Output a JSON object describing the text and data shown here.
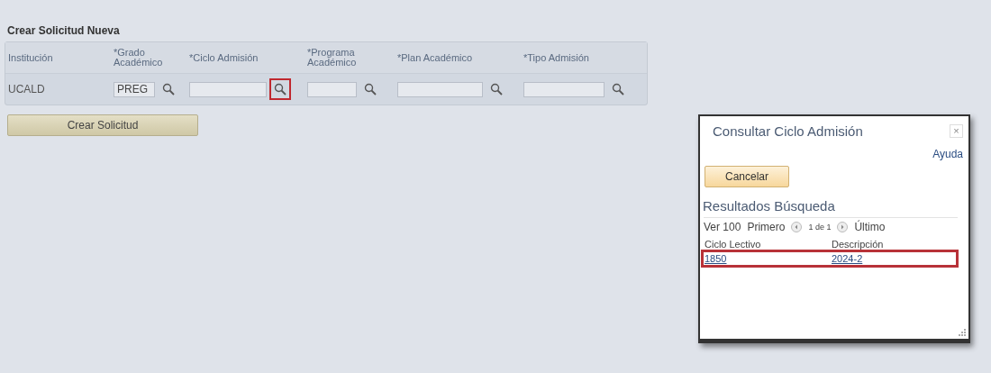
{
  "form": {
    "title": "Crear Solicitud Nueva",
    "columns": [
      "Institución",
      "*Grado Académico",
      "*Ciclo Admisión",
      "*Programa Académico",
      "*Plan Académico",
      "*Tipo Admisión"
    ],
    "cells": [
      {
        "kind": "text",
        "value": "UCALD"
      },
      {
        "kind": "lookup",
        "value": "PREG",
        "highlighted": false
      },
      {
        "kind": "lookup",
        "highlighted": true
      },
      {
        "kind": "lookup",
        "highlighted": false
      },
      {
        "kind": "lookup",
        "highlighted": false
      },
      {
        "kind": "lookup",
        "highlighted": false
      }
    ],
    "button": "Crear Solicitud"
  },
  "dialog": {
    "title": "Consultar Ciclo Admisión",
    "close": "×",
    "help": "Ayuda",
    "cancel": "Cancelar",
    "results_title": "Resultados Búsqueda",
    "nav": {
      "view": "Ver 100",
      "first": "Primero",
      "count": "1 de 1",
      "last": "Último"
    },
    "columns": [
      "Ciclo Lectivo",
      "Descripción"
    ],
    "rows": [
      {
        "cells": [
          "1850",
          "2024-2"
        ],
        "highlighted": true
      }
    ]
  }
}
